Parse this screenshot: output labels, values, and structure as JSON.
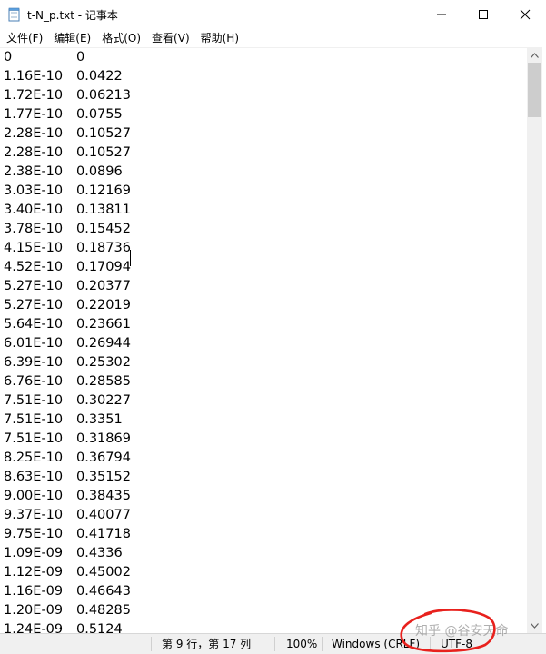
{
  "window": {
    "title": "t-N_p.txt - 记事本"
  },
  "menu": [
    {
      "label": "文件(F)"
    },
    {
      "label": "编辑(E)"
    },
    {
      "label": "格式(O)"
    },
    {
      "label": "查看(V)"
    },
    {
      "label": "帮助(H)"
    }
  ],
  "editor": {
    "lines": [
      [
        "0",
        "0"
      ],
      [
        "1.16E-10",
        "0.0422"
      ],
      [
        "1.72E-10",
        "0.06213"
      ],
      [
        "1.77E-10",
        "0.0755"
      ],
      [
        "2.28E-10",
        "0.10527"
      ],
      [
        "2.28E-10",
        "0.10527"
      ],
      [
        "2.38E-10",
        "0.0896"
      ],
      [
        "3.03E-10",
        "0.12169"
      ],
      [
        "3.40E-10",
        "0.13811"
      ],
      [
        "3.78E-10",
        "0.15452"
      ],
      [
        "4.15E-10",
        "0.18736"
      ],
      [
        "4.52E-10",
        "0.17094"
      ],
      [
        "5.27E-10",
        "0.20377"
      ],
      [
        "5.27E-10",
        "0.22019"
      ],
      [
        "5.64E-10",
        "0.23661"
      ],
      [
        "6.01E-10",
        "0.26944"
      ],
      [
        "6.39E-10",
        "0.25302"
      ],
      [
        "6.76E-10",
        "0.28585"
      ],
      [
        "7.51E-10",
        "0.30227"
      ],
      [
        "7.51E-10",
        "0.3351"
      ],
      [
        "7.51E-10",
        "0.31869"
      ],
      [
        "8.25E-10",
        "0.36794"
      ],
      [
        "8.63E-10",
        "0.35152"
      ],
      [
        "9.00E-10",
        "0.38435"
      ],
      [
        "9.37E-10",
        "0.40077"
      ],
      [
        "9.75E-10",
        "0.41718"
      ],
      [
        "1.09E-09",
        "0.4336"
      ],
      [
        "1.12E-09",
        "0.45002"
      ],
      [
        "1.16E-09",
        "0.46643"
      ],
      [
        "1.20E-09",
        "0.48285"
      ],
      [
        "1.24E-09",
        "0.5124"
      ]
    ]
  },
  "statusbar": {
    "position": "第 9 行，第 17 列",
    "zoom": "100%",
    "line_ending": "Windows (CRLF)",
    "encoding": "UTF-8"
  },
  "watermark": {
    "text": "知乎 @谷安天命"
  },
  "colors": {
    "annotation": "#e8211d",
    "scroll_track": "#f0f0f0",
    "scroll_thumb": "#cdcdcd",
    "statusbar_bg": "#f0f0f0"
  }
}
